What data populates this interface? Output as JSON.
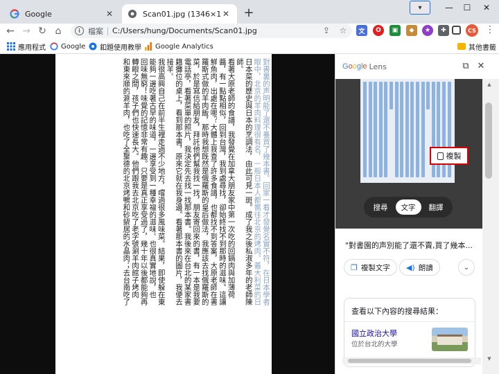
{
  "tabs": [
    {
      "title": "Google",
      "active": false
    },
    {
      "title": "Scan01.jpg (1346×1992)",
      "active": true
    }
  ],
  "window": {
    "tab_search": "▾",
    "minimize": "—",
    "maximize": "☐",
    "close": "✕"
  },
  "omnibox": {
    "scheme": "檔案",
    "url": "C:/Users/hung/Documents/Scan01.jpg"
  },
  "profile": {
    "initials": "CS"
  },
  "bookmarks": [
    {
      "label": "應用程式"
    },
    {
      "label": "Google"
    },
    {
      "label": "釦題使用教學"
    },
    {
      "label": "Google Analytics"
    }
  ],
  "bookmarks_other": "其他書籤",
  "document_columns": [
    "對書裏的声明能了還不養買了幾本書。回家一看才發覺名實不符，在日本學者",
    "眼中，北京的羊肉料理很有名，一般日本人都嚮往北京的烤肉。義大利菜的日",
    "日本菜的歷史與日本的烹調法，由此可見一斑。成了我之後私淑多年的老師陳",
    "師。",
    "看著大原老師的食譜，我發覺在加拿大朋友家中第一次吃的回鍋肉與加薄荷",
    "醬，有一點點相似，回到台灣，我到處尋找，卻始終找不到那時的滋味。這讓",
    "鮮魚肉，出處在哪？大體上我查了許多食譜，也都找不到答案，大原老師在書",
    "羅斯式做的羊肉飯，那時我想既然是俄羅斯的皇后做法，我應該去找俄羅斯的",
    "菜，於是寫信給朋友，拜託他們幫我找一找，朋友寄回來的書，有一本是我要",
    "電話亭，看著菜單的照片，我決定先去找一找那本書。我後來在台北的某家書",
    "籍攤位的桌上，看到那本書，原來它就在我身邊。看著那本書的圖片，我便去",
    "接羊。",
    "我很高興自己在前半生裡走過不少地方，嚐過很多風味菜。結果，即使躲在東",
    "能夠一邊吃著古早的味道，一邊享受到一種幸福的滋味。也很真實地說，也",
    "回味無窮！味覺的記憶非常有趣。只要是真正享受過了，幾十年以後都能夠再",
    "轉眼之間，孩子們也快速長大。他們跟我去北京吃了老字號涮羊肉館子烤肉",
    "和東來順的涮羊肉，也吃了全聚德的北京烤鴨和砂鍋居的水晶肉；去台南吃了"
  ],
  "lens": {
    "title_brand": "Google",
    "title_word": "Lens",
    "copy_button": "複製",
    "modes": [
      "搜尋",
      "文字",
      "翻譯"
    ],
    "active_mode": "文字",
    "snippet": "\"對書園的声別能了還不賣,買了幾本...",
    "copy_text_button": "複製文字",
    "read_aloud_button": "朗讀",
    "results_header": "查看以下內容的搜尋結果：",
    "result": {
      "title": "國立政治大學",
      "subtitle": "位於台北的大學"
    }
  }
}
